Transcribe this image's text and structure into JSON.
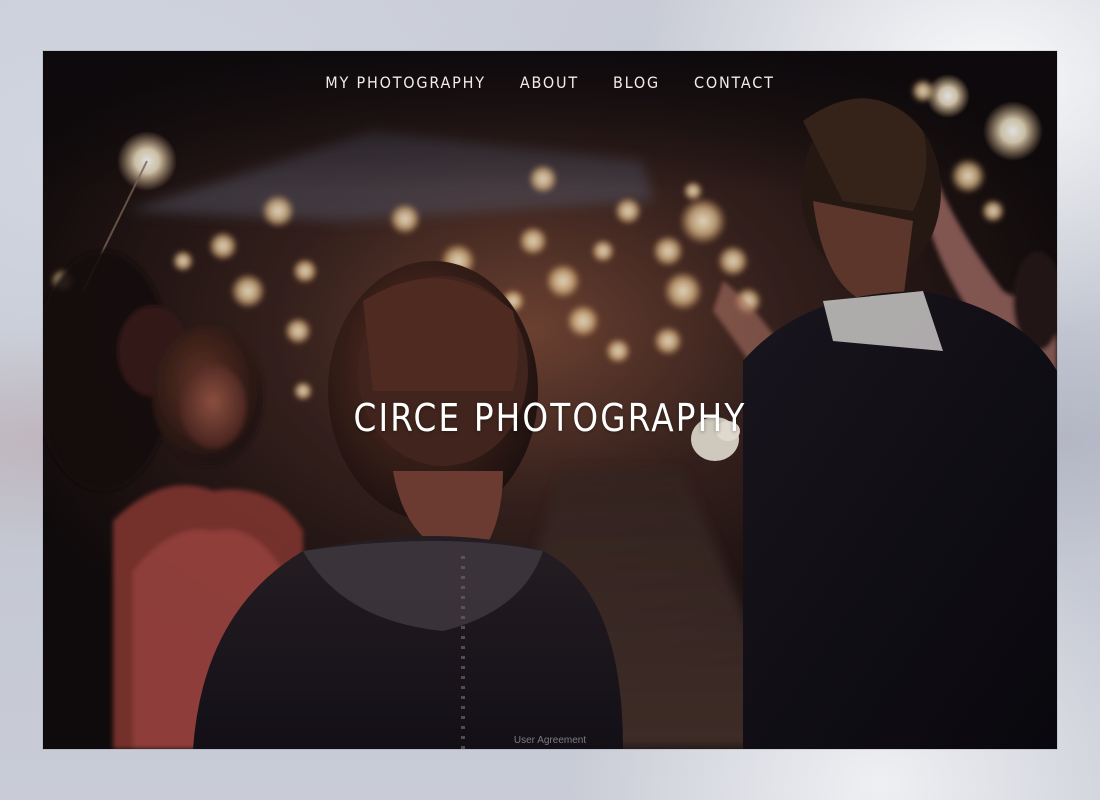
{
  "nav": {
    "items": [
      {
        "label": "MY PHOTOGRAPHY"
      },
      {
        "label": "ABOUT"
      },
      {
        "label": "BLOG"
      },
      {
        "label": "CONTACT"
      }
    ]
  },
  "hero": {
    "title": "CIRCE PHOTOGRAPHY"
  },
  "footer": {
    "link_label": "User Agreement"
  },
  "colors": {
    "nav_text": "#f1ece8",
    "title_text": "#ffffff",
    "page_backdrop": "#c5c9d3"
  }
}
